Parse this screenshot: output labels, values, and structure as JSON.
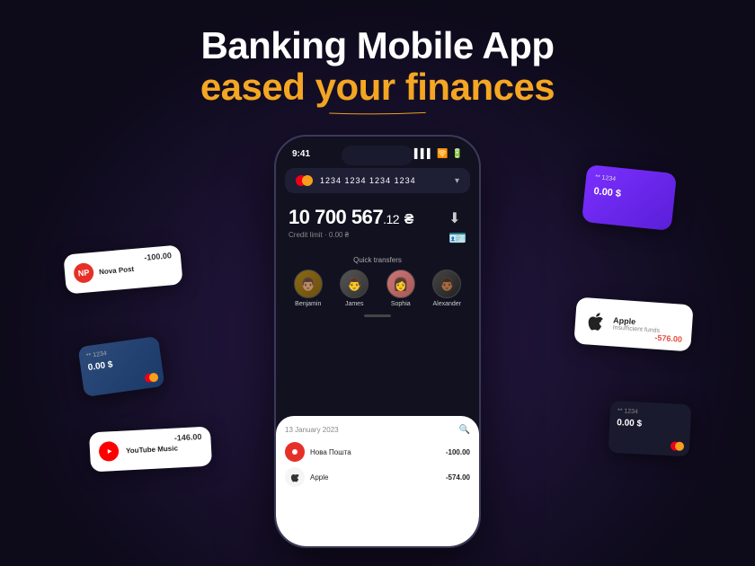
{
  "header": {
    "title": "Banking Mobile App",
    "subtitle": "eased your finances"
  },
  "phone": {
    "status_time": "9:41",
    "card_number": "1234 1234 1234 1234",
    "balance": "10 700 567",
    "balance_decimal": ".12",
    "balance_currency": "₴",
    "credit_limit": "Credit limit · 0.00 ₴",
    "quick_transfers_label": "Quick transfers",
    "contacts": [
      {
        "name": "Benjamin"
      },
      {
        "name": "James"
      },
      {
        "name": "Sophia"
      },
      {
        "name": "Alexander"
      }
    ],
    "transaction_date": "13 January 2023",
    "transactions": [
      {
        "name": "Нова Пошта",
        "amount": "-100.00"
      },
      {
        "name": "Apple",
        "amount": "-574.00"
      }
    ]
  },
  "floating_cards": {
    "nova_post": {
      "name": "Nova Post",
      "amount": "-100.00"
    },
    "youtube_music": {
      "name": "YouTube Music",
      "amount": "-146.00"
    },
    "blue_card": {
      "stars": "** 1234",
      "balance": "0.00 $"
    },
    "purple_card": {
      "stars": "** 1234",
      "balance": "0.00 $"
    },
    "apple": {
      "name": "Apple",
      "sub": "Insufficient funds",
      "amount": "-576.00"
    },
    "bottom_right": {
      "stars": "** 1234",
      "balance": "0.00 $"
    }
  },
  "colors": {
    "accent": "#f5a623",
    "bg": "#0d0a1a",
    "purple": "#7b2fff"
  }
}
